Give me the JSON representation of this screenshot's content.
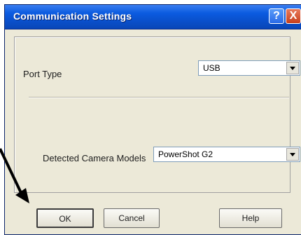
{
  "window": {
    "title": "Communication Settings",
    "help_button": "?",
    "close_button": "X"
  },
  "port": {
    "label": "Port Type",
    "value": "USB"
  },
  "camera": {
    "label": "Detected Camera Models",
    "value": "PowerShot G2"
  },
  "buttons": {
    "ok": "OK",
    "cancel": "Cancel",
    "help": "Help"
  }
}
